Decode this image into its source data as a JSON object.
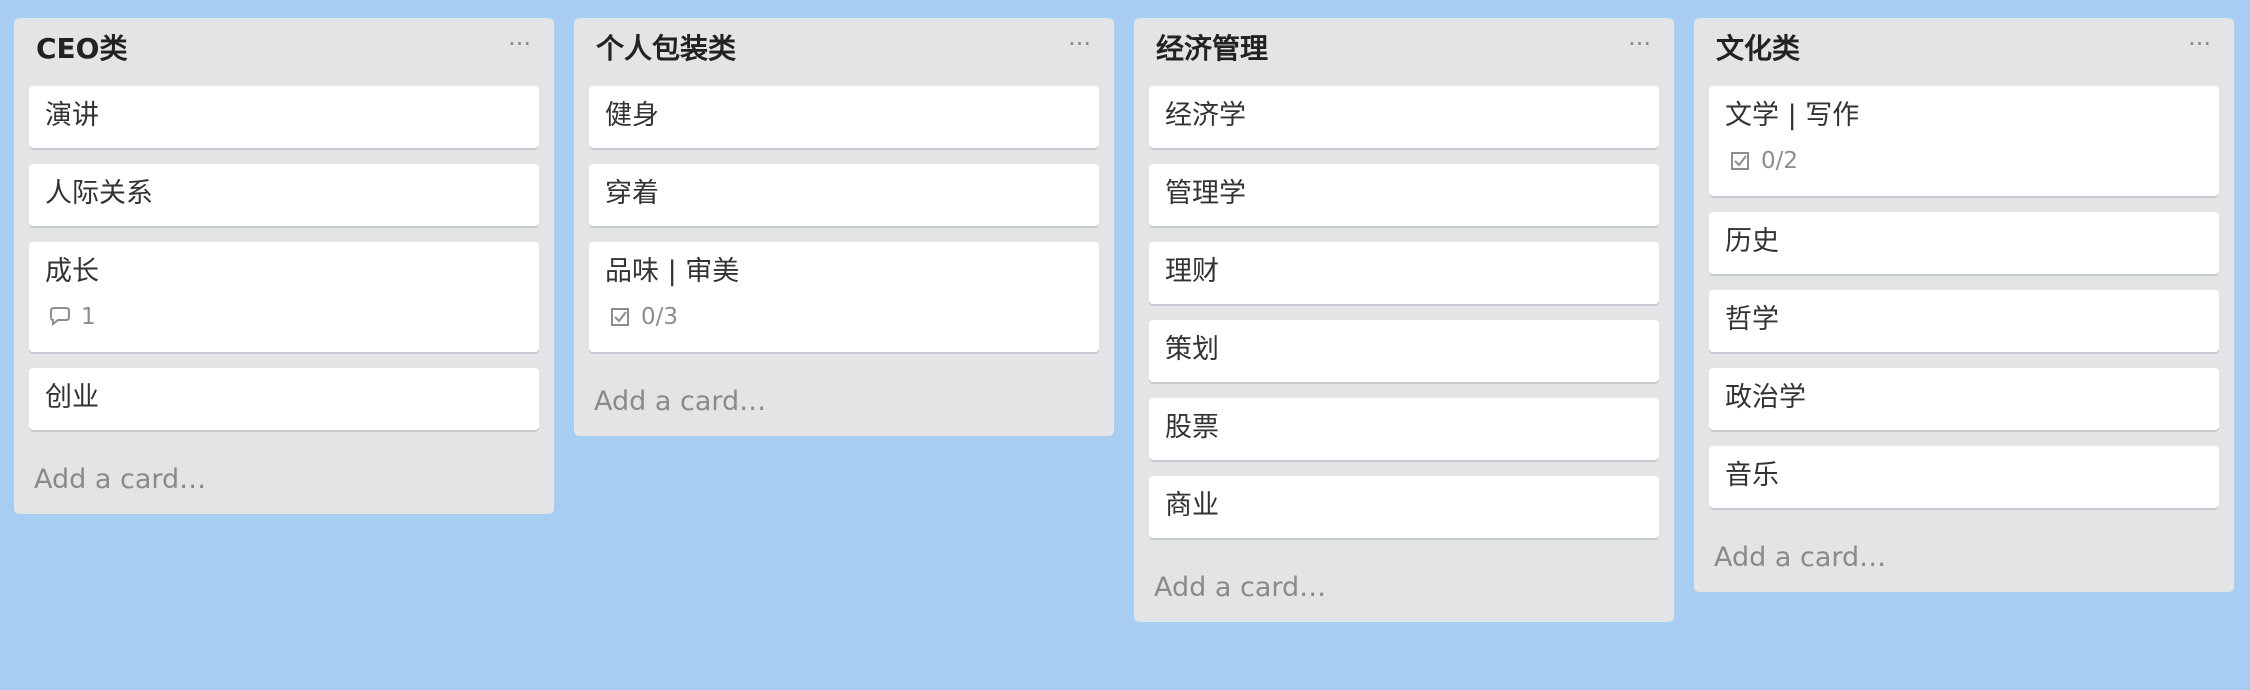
{
  "lists": [
    {
      "title": "CEO类",
      "menu_label": "···",
      "add_label": "Add a card…",
      "cards": [
        {
          "title": "演讲"
        },
        {
          "title": "人际关系"
        },
        {
          "title": "成长",
          "badge_icon": "comment-icon",
          "badge_text": "1"
        },
        {
          "title": "创业"
        }
      ]
    },
    {
      "title": "个人包装类",
      "menu_label": "···",
      "add_label": "Add a card…",
      "cards": [
        {
          "title": "健身"
        },
        {
          "title": "穿着"
        },
        {
          "title": "品味 | 审美",
          "badge_icon": "checklist-icon",
          "badge_text": "0/3"
        }
      ]
    },
    {
      "title": "经济管理",
      "menu_label": "···",
      "add_label": "Add a card…",
      "cards": [
        {
          "title": "经济学"
        },
        {
          "title": "管理学"
        },
        {
          "title": "理财"
        },
        {
          "title": "策划"
        },
        {
          "title": "股票"
        },
        {
          "title": "商业"
        }
      ]
    },
    {
      "title": "文化类",
      "menu_label": "···",
      "add_label": "Add a card…",
      "cards": [
        {
          "title": "文学 | 写作",
          "badge_icon": "checklist-icon",
          "badge_text": "0/2"
        },
        {
          "title": "历史"
        },
        {
          "title": "哲学"
        },
        {
          "title": "政治学"
        },
        {
          "title": "音乐"
        }
      ]
    }
  ],
  "colors": {
    "board_background": "#a7cef2",
    "list_background": "#e2e4e6",
    "card_background": "#ffffff"
  }
}
